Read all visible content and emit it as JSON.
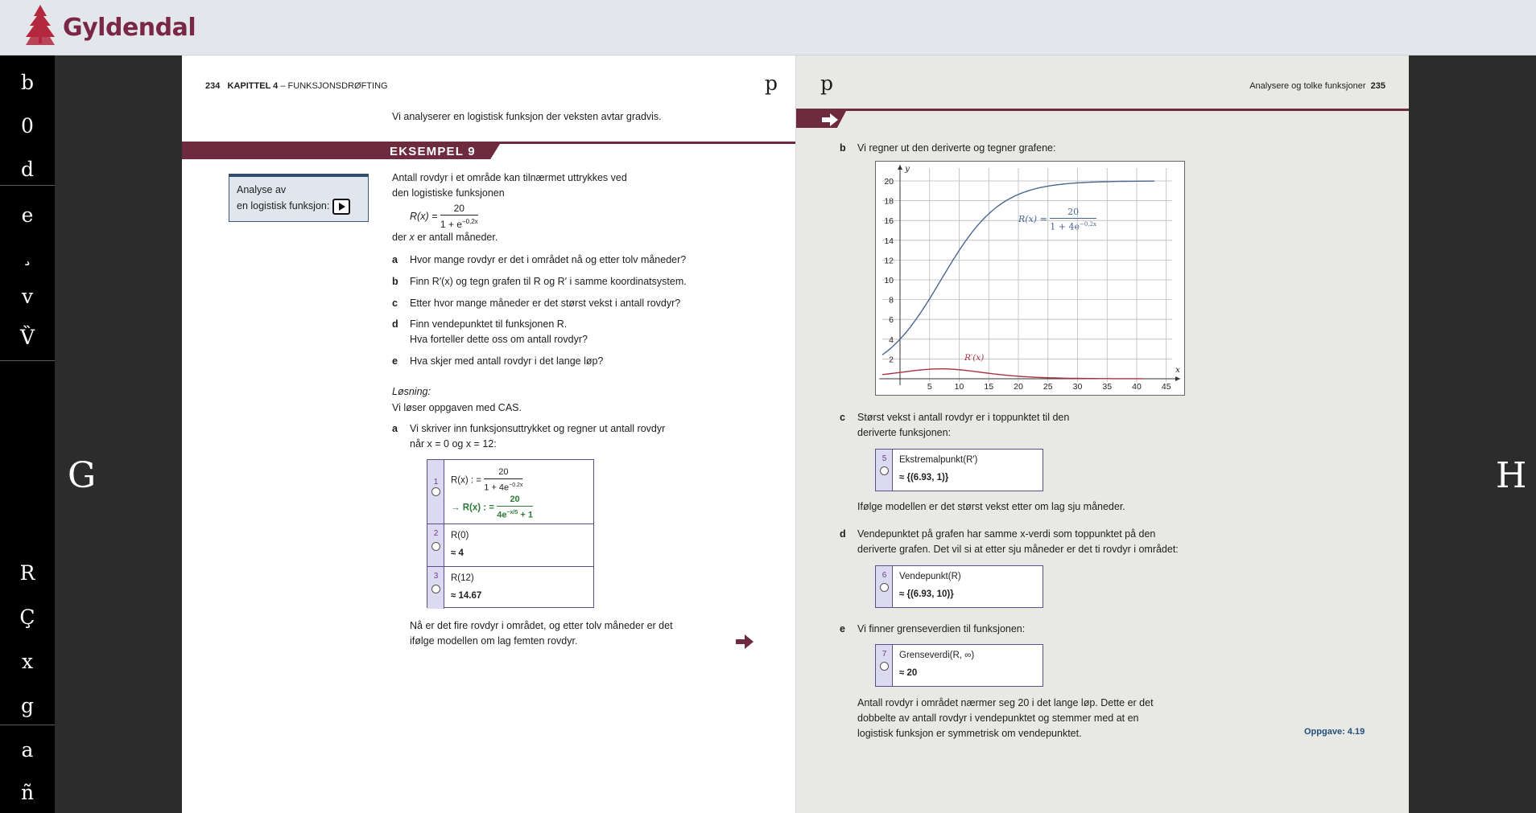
{
  "header": {
    "brand": "Gyldendal",
    "brand_color": "#7a2745",
    "icon": "tree-logo-icon"
  },
  "sidebar": {
    "items": [
      {
        "glyph": "b",
        "icon": "toolbar-b-icon"
      },
      {
        "glyph": "0",
        "icon": "toolbar-0-icon"
      },
      {
        "glyph": "d",
        "icon": "toolbar-d-icon"
      },
      {
        "glyph": "e",
        "icon": "toolbar-e-icon"
      },
      {
        "glyph": "¸",
        "icon": "toolbar-cedilla-icon"
      },
      {
        "glyph": "v",
        "icon": "toolbar-v-icon"
      },
      {
        "glyph": "V̏",
        "icon": "toolbar-v-double-grave-icon"
      },
      {
        "glyph": "R",
        "icon": "toolbar-r-icon"
      },
      {
        "glyph": "Ç",
        "icon": "toolbar-c-cedilla-icon"
      },
      {
        "glyph": "x",
        "icon": "toolbar-x-icon"
      },
      {
        "glyph": "g",
        "icon": "toolbar-g-icon"
      },
      {
        "glyph": "a",
        "icon": "toolbar-a-icon"
      },
      {
        "glyph": "ñ",
        "icon": "toolbar-n-tilde-icon"
      }
    ]
  },
  "nav": {
    "prev": "G",
    "next": "H"
  },
  "left_page": {
    "page_number": "234",
    "chapter": "KAPITTEL 4",
    "chapter_rest": " – FUNKSJONSDRØFTING",
    "corner_glyph": "p",
    "intro": "Vi analyserer en logistisk funksjon der veksten avtar gradvis.",
    "example_label": "EKSEMPEL 9",
    "side_box": {
      "line1": "Analyse av",
      "line2": "en logistisk funksjon:",
      "icon": "play-video-icon"
    },
    "problem_line1": "Antall rovdyr i et område kan tilnærmet uttrykkes ved",
    "problem_line2": "den logistiske funksjonen",
    "formula_lhs": "R(x) =",
    "formula_num": "20",
    "formula_den": "1 + e",
    "formula_exp": "−0,2x",
    "problem_line3_pre": "der ",
    "problem_line3_var": "x",
    "problem_line3_post": " er antall måneder.",
    "tasks": [
      {
        "letter": "a",
        "text": "Hvor mange rovdyr er det i området nå og etter tolv måneder?"
      },
      {
        "letter": "b",
        "text": "Finn R′(x) og tegn grafen til R og R′ i samme koordinatsystem."
      },
      {
        "letter": "c",
        "text": "Etter hvor mange måneder er det størst vekst i antall rovdyr?"
      },
      {
        "letter": "d",
        "text": "Finn vendepunktet til funksjonen R."
      },
      {
        "letter": "d2",
        "text": "Hva forteller dette oss om antall rovdyr?"
      },
      {
        "letter": "e",
        "text": "Hva skjer med antall rovdyr i det lange løp?"
      }
    ],
    "solution_title": "Løsning:",
    "solution_intro": "Vi løser oppgaven med CAS.",
    "sol_a_letter": "a",
    "sol_a_line1": "Vi skriver inn funksjonsuttrykket og regner ut antall rovdyr",
    "sol_a_line2": "når x = 0 og x = 12:",
    "cas": [
      {
        "n": "1",
        "input_lhs": "R(x) : =",
        "input_num": "20",
        "input_den": "1 + 4e",
        "input_exp": "−0.2x",
        "output_lhs": "→  R(x) : =",
        "output_num": "20",
        "output_den": "4e",
        "output_den_exp": "−x/5",
        "output_den_post": " + 1"
      },
      {
        "n": "2",
        "input": "R(0)",
        "output": "≈ 4"
      },
      {
        "n": "3",
        "input": "R(12)",
        "output": "≈ 14.67"
      }
    ],
    "conclusion_line1": "Nå er det fire rovdyr i området, og etter tolv måneder er det",
    "conclusion_line2": "ifølge modellen om lag femten rovdyr.",
    "next_arrow": "next-arrow-icon"
  },
  "right_page": {
    "corner_glyph": "p",
    "section": "Analysere og tolke funksjoner",
    "page_number": "235",
    "arrow_icon": "arrow-right-icon",
    "b_letter": "b",
    "b_text": "Vi regner ut den deriverte og tegner grafene:",
    "graph": {
      "y_label": "y",
      "x_label": "x",
      "x_ticks": [
        "5",
        "10",
        "15",
        "20",
        "25",
        "30",
        "35",
        "40",
        "45"
      ],
      "y_ticks": [
        "2",
        "4",
        "6",
        "8",
        "10",
        "12",
        "14",
        "16",
        "18",
        "20"
      ],
      "r_label": "R(x) =",
      "r_num": "20",
      "r_den": "1 + 4e",
      "r_exp": "−0,2x",
      "rp_label": "R′(x)",
      "r_color": "#4a6690",
      "rp_color": "#a8333f"
    },
    "c_letter": "c",
    "c_line1": "Størst vekst i antall rovdyr er i toppunktet til den",
    "c_line2": "deriverte funksjonen:",
    "cas_c": {
      "n": "5",
      "input": "Ekstremalpunkt(R′)",
      "output": "≈ {(6.93, 1)}"
    },
    "c_result": "Ifølge modellen er det størst vekst etter om lag sju måneder.",
    "d_letter": "d",
    "d_line1": "Vendepunktet på grafen har samme x-verdi som toppunktet på den",
    "d_line2": "deriverte grafen. Det vil si at etter sju måneder er det ti rovdyr i området:",
    "cas_d": {
      "n": "6",
      "input": "Vendepunkt(R)",
      "output": "≈ {(6.93, 10)}"
    },
    "e_letter": "e",
    "e_text": "Vi finner grenseverdien til funksjonen:",
    "cas_e": {
      "n": "7",
      "input": "Grenseverdi(R, ∞)",
      "output": "≈ 20"
    },
    "e_line1": "Antall rovdyr i området nærmer seg 20 i det lange løp. Dette er det",
    "e_line2": "dobbelte av antall rovdyr i vendepunktet og stemmer med at en",
    "e_line3": "logistisk funksjon er symmetrisk om vendepunktet.",
    "exercise_link": "Oppgave: 4.19"
  },
  "colors": {
    "accent": "#6e2a3e",
    "cas_border": "#5a4f8a",
    "cas_gutter": "#dcdaf0",
    "cas_green": "#2f7a3a"
  }
}
